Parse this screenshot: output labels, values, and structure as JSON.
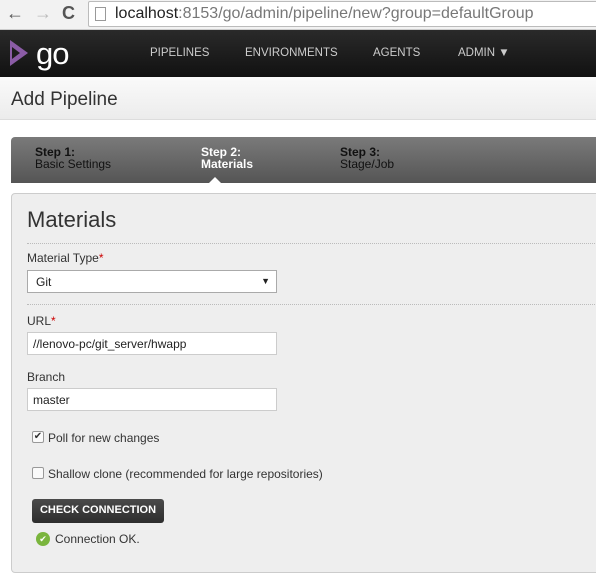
{
  "browser": {
    "url_host": "localhost",
    "url_rest": ":8153/go/admin/pipeline/new?group=defaultGroup",
    "back": "←",
    "forward": "→",
    "reload": "C"
  },
  "nav": {
    "logo": "go",
    "items": [
      "PIPELINES",
      "ENVIRONMENTS",
      "AGENTS",
      "ADMIN ▼"
    ]
  },
  "page": {
    "title": "Add Pipeline"
  },
  "steps": [
    {
      "num": "Step 1:",
      "name": "Basic Settings"
    },
    {
      "num": "Step 2:",
      "name": "Materials"
    },
    {
      "num": "Step 3:",
      "name": "Stage/Job"
    }
  ],
  "form": {
    "heading": "Materials",
    "material_type_label": "Material Type",
    "required": "*",
    "material_type": "Git",
    "url_label": "URL",
    "url": "//lenovo-pc/git_server/hwapp",
    "branch_label": "Branch",
    "branch": "master",
    "poll_label": "Poll for new changes",
    "poll_checked": true,
    "shallow_label": "Shallow clone (recommended for large repositories)",
    "shallow_checked": false,
    "check_button": "CHECK CONNECTION",
    "status": "Connection OK.",
    "status_color": "#7ab53d"
  }
}
